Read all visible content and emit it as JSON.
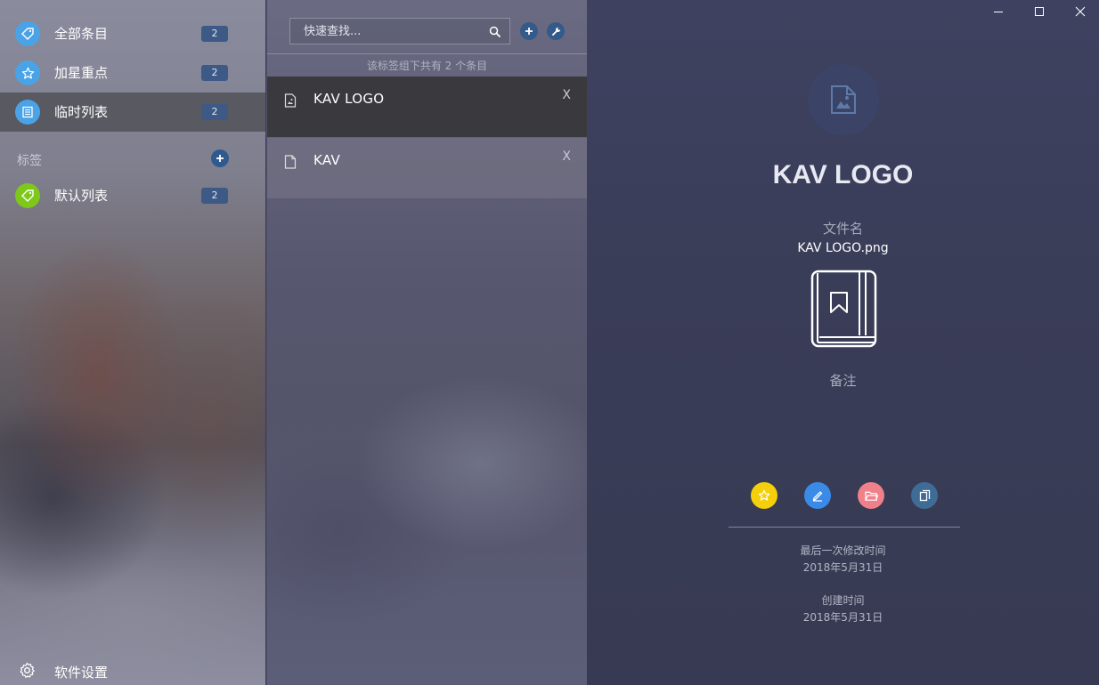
{
  "sidebar": {
    "items": [
      {
        "label": "全部条目",
        "count": "2",
        "icon": "tag-icon",
        "color": "#4aa3e6"
      },
      {
        "label": "加星重点",
        "count": "2",
        "icon": "star-icon",
        "color": "#4aa3e6"
      },
      {
        "label": "临时列表",
        "count": "2",
        "icon": "list-icon",
        "color": "#4aa3e6",
        "active": true
      }
    ],
    "tags_section_label": "标签",
    "tags": [
      {
        "label": "默认列表",
        "count": "2",
        "icon": "tag-icon",
        "color": "#7ec81a"
      }
    ],
    "settings_label": "软件设置"
  },
  "list": {
    "search_placeholder": "快速查找...",
    "group_info": "该标签组下共有 2 个条目",
    "entries": [
      {
        "title": "KAV LOGO",
        "icon": "image-file-icon",
        "selected": true
      },
      {
        "title": "KAV",
        "icon": "file-icon",
        "selected": false
      }
    ],
    "close_glyph": "X"
  },
  "detail": {
    "title": "KAV LOGO",
    "filename_label": "文件名",
    "filename": "KAV LOGO.png",
    "note_label": "备注",
    "modified_label": "最后一次修改时间",
    "modified_value": "2018年5月31日",
    "created_label": "创建时间",
    "created_value": "2018年5月31日",
    "actions": [
      {
        "name": "star-icon",
        "color": "#f5cf0a"
      },
      {
        "name": "edit-icon",
        "color": "#3a8be8"
      },
      {
        "name": "folder-icon",
        "color": "#f0808a"
      },
      {
        "name": "copy-icon",
        "color": "#3f6c96"
      }
    ]
  },
  "colors": {
    "accent_blue": "#4aa3e6",
    "tag_green": "#7ec81a",
    "badge": "#3c5a85"
  }
}
